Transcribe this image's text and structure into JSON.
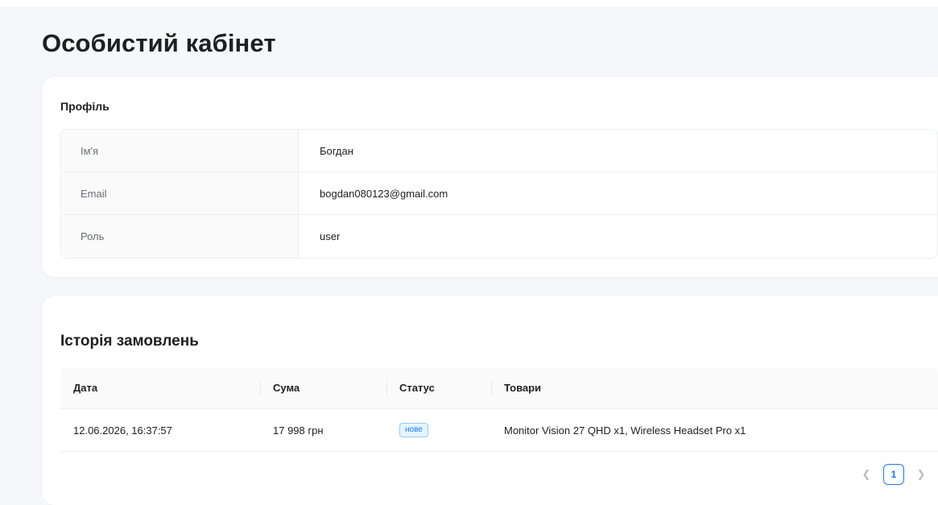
{
  "page": {
    "title": "Особистий кабінет"
  },
  "profile": {
    "title": "Профіль",
    "rows": [
      {
        "label": "Ім'я",
        "value": "Богдан"
      },
      {
        "label": "Email",
        "value": "bogdan080123@gmail.com"
      },
      {
        "label": "Роль",
        "value": "user"
      }
    ]
  },
  "orders": {
    "title": "Історія замовлень",
    "columns": {
      "date": "Дата",
      "sum": "Сума",
      "status": "Статус",
      "items": "Товари"
    },
    "rows": [
      {
        "date": "12.06.2026, 16:37:57",
        "sum": "17 998 грн",
        "status": "нове",
        "items": "Monitor Vision 27 QHD x1, Wireless Headset Pro x1"
      }
    ],
    "pagination": {
      "prev_icon": "chevron-left-icon",
      "current_page": "1",
      "next_icon": "chevron-right-icon"
    }
  },
  "colors": {
    "accent": "#1677ff",
    "background": "#f5f7fa",
    "card": "#ffffff"
  }
}
